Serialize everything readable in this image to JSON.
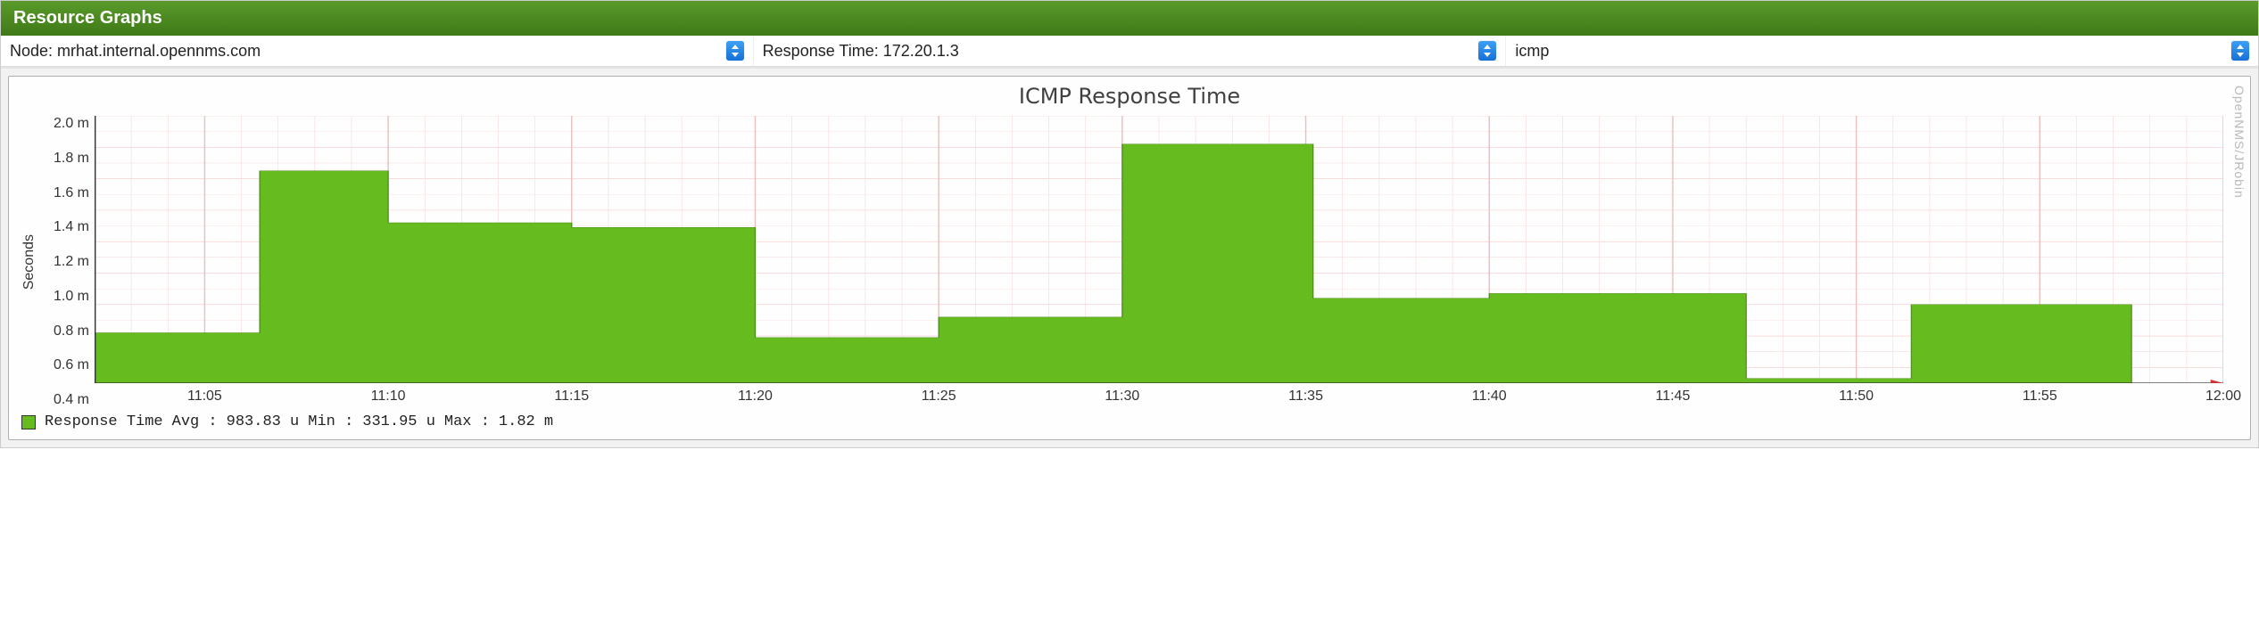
{
  "panel": {
    "title": "Resource Graphs"
  },
  "selectors": {
    "node": "Node: mrhat.internal.opennms.com",
    "resource": "Response Time: 172.20.1.3",
    "metric": "icmp"
  },
  "watermark": "OpenNMS/JRobin",
  "chart_data": {
    "type": "bar",
    "title": "ICMP Response Time",
    "ylabel": "Seconds",
    "xlabel": "",
    "ylim": [
      0.3,
      2.0
    ],
    "y_ticks": [
      "2.0 m",
      "1.8 m",
      "1.6 m",
      "1.4 m",
      "1.2 m",
      "1.0 m",
      "0.8 m",
      "0.6 m",
      "0.4 m"
    ],
    "x_tick_labels": [
      "11:05",
      "11:10",
      "11:15",
      "11:20",
      "11:25",
      "11:30",
      "11:35",
      "11:40",
      "11:45",
      "11:50",
      "11:55",
      "12:00"
    ],
    "x_range_minutes": [
      62,
      120
    ],
    "series": [
      {
        "name": "Response Time",
        "color": "#66bb1f",
        "unit": "milliseconds",
        "intervals": [
          {
            "from": 62.0,
            "to": 66.5,
            "value": 0.62
          },
          {
            "from": 66.5,
            "to": 70.0,
            "value": 1.65
          },
          {
            "from": 70.0,
            "to": 75.0,
            "value": 1.32
          },
          {
            "from": 75.0,
            "to": 80.0,
            "value": 1.29
          },
          {
            "from": 80.0,
            "to": 85.0,
            "value": 0.59
          },
          {
            "from": 85.0,
            "to": 90.0,
            "value": 0.72
          },
          {
            "from": 90.0,
            "to": 95.2,
            "value": 1.82
          },
          {
            "from": 95.2,
            "to": 100.0,
            "value": 0.84
          },
          {
            "from": 100.0,
            "to": 107.0,
            "value": 0.87
          },
          {
            "from": 107.0,
            "to": 111.5,
            "value": 0.33
          },
          {
            "from": 111.5,
            "to": 117.5,
            "value": 0.8
          }
        ]
      }
    ]
  },
  "legend": {
    "series_name": "Response Time",
    "avg_label": "Avg :",
    "avg_value": "983.83 u",
    "min_label": "Min :",
    "min_value": "331.95 u",
    "max_label": "Max :",
    "max_value": "1.82 m"
  }
}
